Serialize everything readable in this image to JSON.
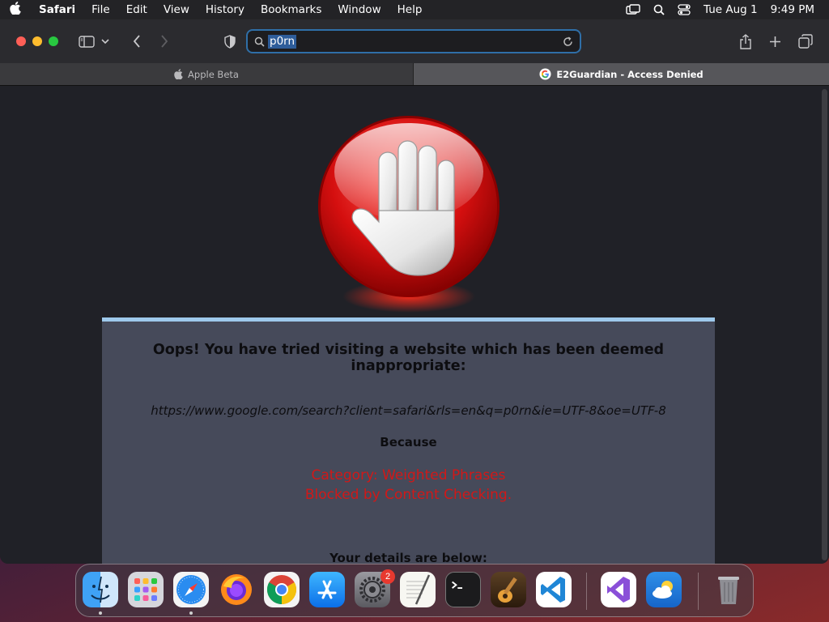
{
  "menubar": {
    "app": "Safari",
    "items": [
      "File",
      "Edit",
      "View",
      "History",
      "Bookmarks",
      "Window",
      "Help"
    ],
    "date": "Tue Aug 1",
    "time": "9:49 PM"
  },
  "address_bar": {
    "query": "p0rn"
  },
  "tabs": [
    {
      "label": "Apple Beta",
      "icon": "apple-icon",
      "active": false
    },
    {
      "label": "E2Guardian - Access Denied",
      "icon": "google-icon",
      "active": true
    }
  ],
  "page": {
    "headline": "Oops! You have tried visiting a website which has been deemed inappropriate:",
    "blocked_url": "https://www.google.com/search?client=safari&rls=en&q=p0rn&ie=UTF-8&oe=UTF-8",
    "because": "Because",
    "category_line": "Category: Weighted Phrases",
    "reason_line": "Blocked by Content Checking.",
    "details": "Your details are below:"
  },
  "colors": {
    "panel_bg": "#464a5a",
    "panel_border": "#9ec9ec",
    "reason_red": "#d11818",
    "address_focus": "#2f6fa8"
  },
  "dock": {
    "apps": [
      "Finder",
      "Launchpad",
      "Safari",
      "Firefox",
      "Chrome",
      "App Store",
      "System Settings",
      "TextEdit",
      "Terminal",
      "GarageBand",
      "Visual Studio Code",
      "Visual Studio",
      "Weather",
      "Trash"
    ],
    "settings_badge": "2"
  }
}
